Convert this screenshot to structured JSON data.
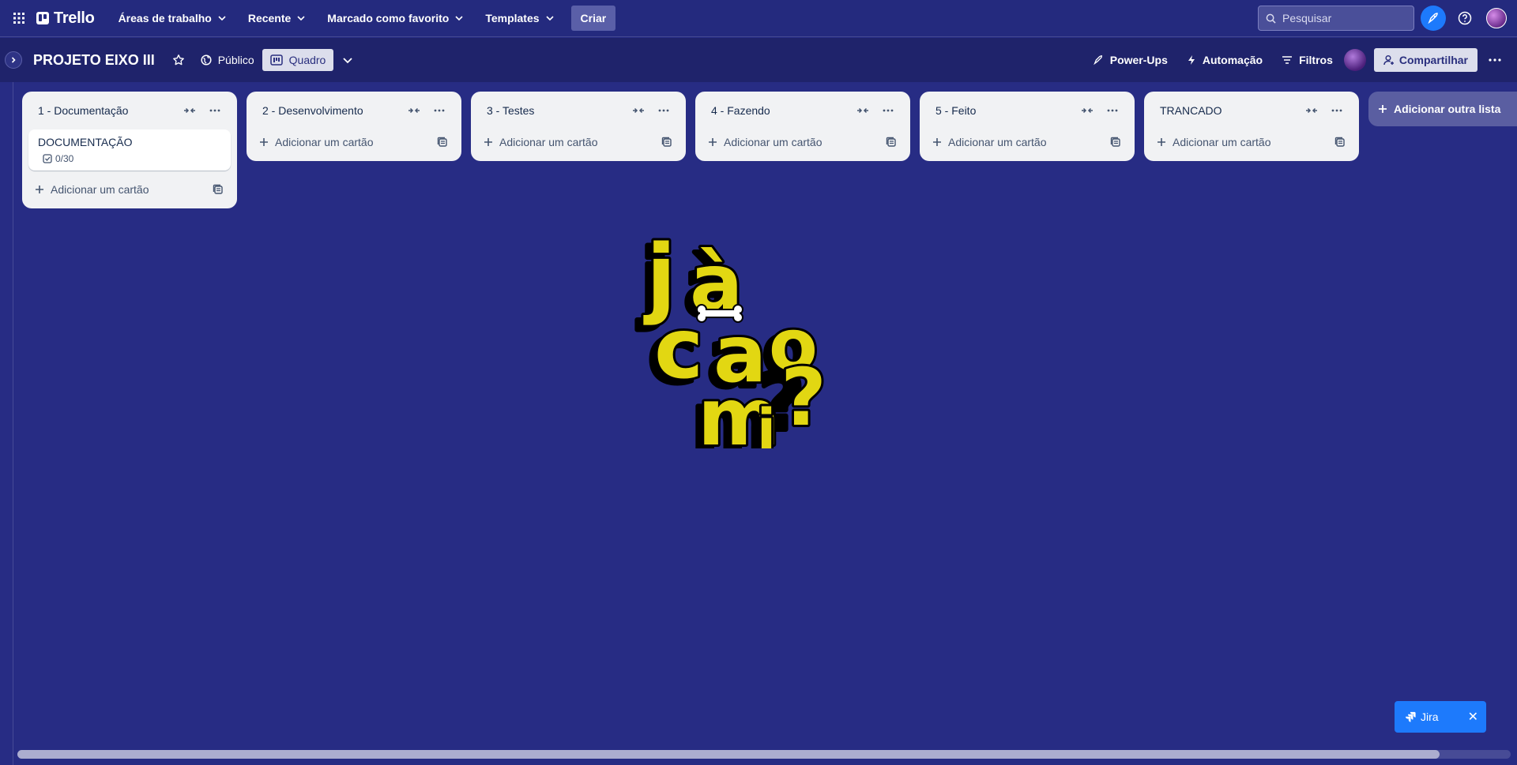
{
  "topbar": {
    "logo_text": "Trello",
    "nav": [
      {
        "label": "Áreas de trabalho"
      },
      {
        "label": "Recente"
      },
      {
        "label": "Marcado como favorito"
      },
      {
        "label": "Templates"
      }
    ],
    "create_label": "Criar",
    "search_placeholder": "Pesquisar"
  },
  "board": {
    "title": "PROJETO EIXO III",
    "visibility_label": "Público",
    "view_label": "Quadro",
    "powerups_label": "Power-Ups",
    "automation_label": "Automação",
    "filters_label": "Filtros",
    "share_label": "Compartilhar"
  },
  "lists": [
    {
      "title": "1 - Documentação",
      "cards": [
        {
          "title": "DOCUMENTAÇÃO",
          "checklist": "0/30"
        }
      ],
      "add_label": "Adicionar um cartão"
    },
    {
      "title": "2 - Desenvolvimento",
      "cards": [],
      "add_label": "Adicionar um cartão"
    },
    {
      "title": "3 - Testes",
      "cards": [],
      "add_label": "Adicionar um cartão"
    },
    {
      "title": "4 - Fazendo",
      "cards": [],
      "add_label": "Adicionar um cartão"
    },
    {
      "title": "5 - Feito",
      "cards": [],
      "add_label": "Adicionar um cartão"
    },
    {
      "title": "TRANCADO",
      "cards": [],
      "add_label": "Adicionar um cartão"
    }
  ],
  "add_list_label": "Adicionar outra lista",
  "sticker": {
    "text": "JÀ CAO MI?"
  },
  "jira": {
    "label": "Jira"
  },
  "colors": {
    "background": "#272C84",
    "accent": "#1D7AFC",
    "sticker_yellow": "#E2D712"
  }
}
